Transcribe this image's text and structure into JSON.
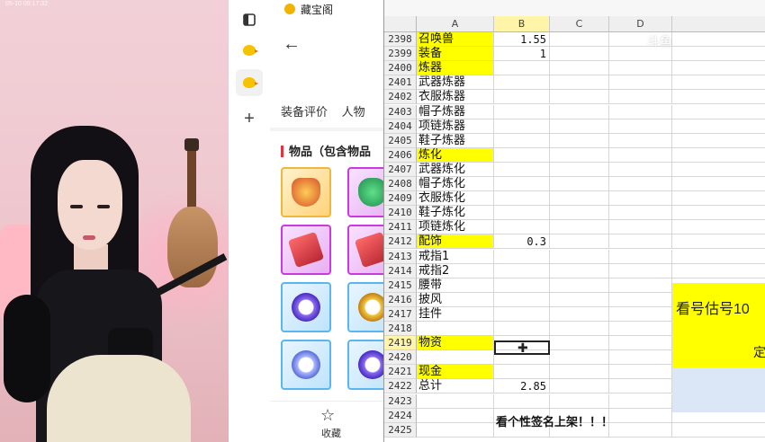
{
  "overlay": {
    "osd_text": "05-10 09:17:32"
  },
  "webapp": {
    "title": "藏宝阁",
    "tabs": [
      "装备评价",
      "人物"
    ],
    "section_title": "物品（包含物品",
    "favorite_label": "收藏"
  },
  "sheet": {
    "columns": [
      "A",
      "B",
      "C",
      "D"
    ],
    "rows": [
      {
        "num": "2398",
        "a": "召唤兽",
        "b": "1.55",
        "hl": true
      },
      {
        "num": "2399",
        "a": "装备",
        "b": "1",
        "hl": true
      },
      {
        "num": "2400",
        "a": "炼器",
        "b": "",
        "hl": true
      },
      {
        "num": "2401",
        "a": "武器炼器",
        "b": "",
        "hl": false
      },
      {
        "num": "2402",
        "a": "衣服炼器",
        "b": "",
        "hl": false
      },
      {
        "num": "2403",
        "a": "帽子炼器",
        "b": "",
        "hl": false
      },
      {
        "num": "2404",
        "a": "项链炼器",
        "b": "",
        "hl": false
      },
      {
        "num": "2405",
        "a": "鞋子炼器",
        "b": "",
        "hl": false
      },
      {
        "num": "2406",
        "a": "炼化",
        "b": "",
        "hl": true
      },
      {
        "num": "2407",
        "a": "武器炼化",
        "b": "",
        "hl": false
      },
      {
        "num": "2408",
        "a": "帽子炼化",
        "b": "",
        "hl": false
      },
      {
        "num": "2409",
        "a": "衣服炼化",
        "b": "",
        "hl": false
      },
      {
        "num": "2410",
        "a": "鞋子炼化",
        "b": "",
        "hl": false
      },
      {
        "num": "2411",
        "a": "项链炼化",
        "b": "",
        "hl": false
      },
      {
        "num": "2412",
        "a": "配饰",
        "b": "0.3",
        "hl": true
      },
      {
        "num": "2413",
        "a": "戒指1",
        "b": "",
        "hl": false
      },
      {
        "num": "2414",
        "a": "戒指2",
        "b": "",
        "hl": false
      },
      {
        "num": "2415",
        "a": "腰带",
        "b": "",
        "hl": false
      },
      {
        "num": "2416",
        "a": "披风",
        "b": "",
        "hl": false
      },
      {
        "num": "2417",
        "a": "挂件",
        "b": "",
        "hl": false
      },
      {
        "num": "2418",
        "a": "",
        "b": "",
        "hl": false
      },
      {
        "num": "2419",
        "a": "物资",
        "b": "",
        "hl": true,
        "sel": true
      },
      {
        "num": "2420",
        "a": "",
        "b": "",
        "hl": false
      },
      {
        "num": "2421",
        "a": "现金",
        "b": "",
        "hl": true
      },
      {
        "num": "2422",
        "a": "总计",
        "b": "2.85",
        "hl": false
      },
      {
        "num": "2423",
        "a": "",
        "b": "",
        "hl": false
      },
      {
        "num": "2424",
        "a": "",
        "b": "",
        "hl": false
      },
      {
        "num": "2425",
        "a": "",
        "b": "",
        "hl": false
      }
    ],
    "side_text": "看号估号10",
    "side_text_2": "定",
    "signature_line": "看个性签名上架！！！"
  },
  "watermark": "斗鱼"
}
